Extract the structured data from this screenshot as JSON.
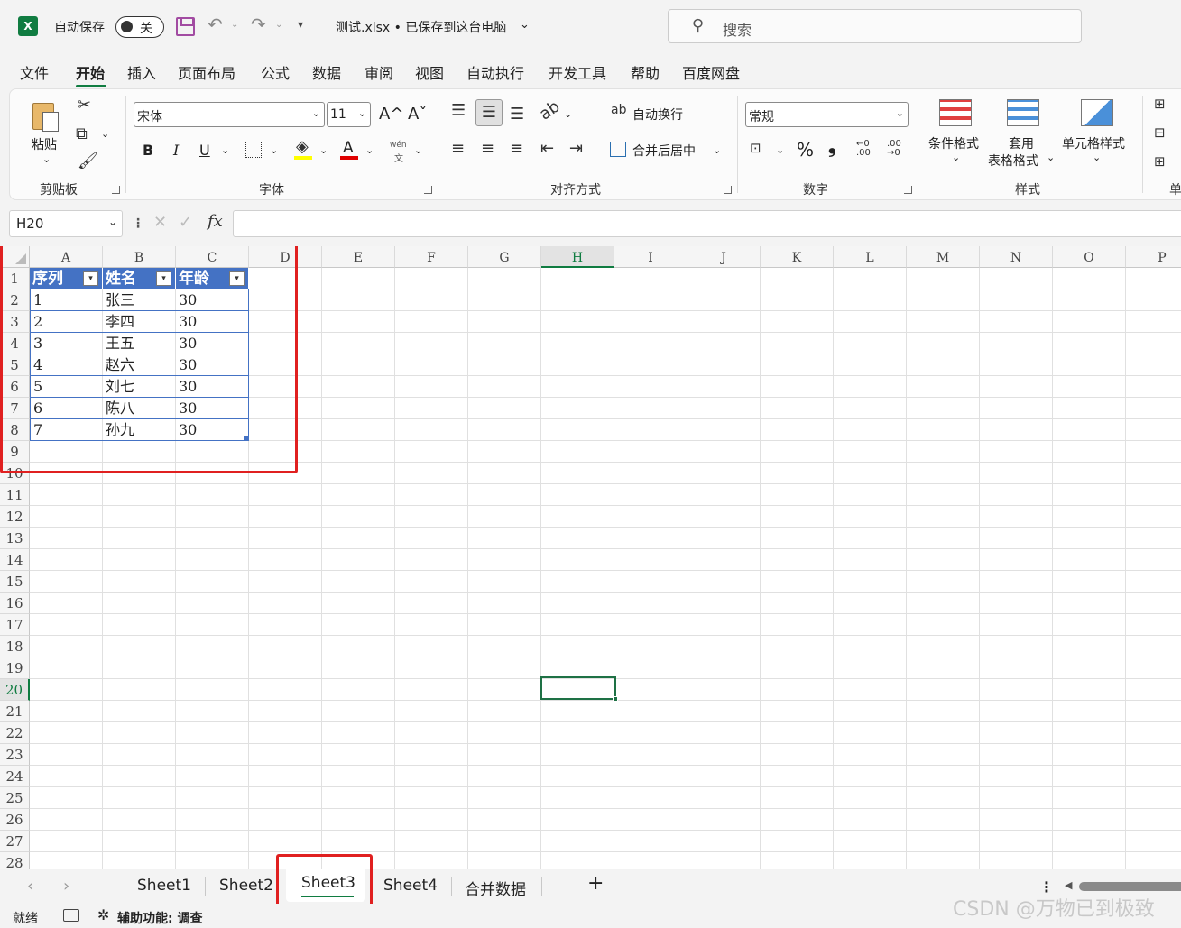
{
  "titlebar": {
    "autosave_label": "自动保存",
    "autosave_state": "关",
    "filename": "测试.xlsx • 已保存到这台电脑",
    "search_placeholder": "搜索"
  },
  "menu": {
    "tabs": [
      "文件",
      "开始",
      "插入",
      "页面布局",
      "公式",
      "数据",
      "审阅",
      "视图",
      "自动执行",
      "开发工具",
      "帮助",
      "百度网盘"
    ],
    "active": "开始"
  },
  "ribbon": {
    "clipboard": {
      "paste_label": "粘贴",
      "group_label": "剪贴板"
    },
    "font": {
      "font_name": "宋体",
      "font_size": "11",
      "bold": "B",
      "italic": "I",
      "underline": "U",
      "font_color_glyph": "A",
      "grow": "A^",
      "shrink": "Aˇ",
      "phonetic_top": "wén",
      "phonetic_bottom": "文",
      "group_label": "字体"
    },
    "alignment": {
      "wrap_text": "自动换行",
      "merge_center": "合并后居中",
      "group_label": "对齐方式"
    },
    "number": {
      "format": "常规",
      "percent": "%",
      "comma": "❟",
      "group_label": "数字"
    },
    "styles": {
      "conditional": "条件格式",
      "table_line1": "套用",
      "table_line2": "表格格式",
      "cell_styles": "单元格样式",
      "group_label": "样式"
    },
    "cells_group_label_partial": "单"
  },
  "formula_bar": {
    "name_box": "H20",
    "fx": "fx",
    "formula": ""
  },
  "grid": {
    "columns": [
      "A",
      "B",
      "C",
      "D",
      "E",
      "F",
      "G",
      "H",
      "I",
      "J",
      "K",
      "L",
      "M",
      "N",
      "O",
      "P"
    ],
    "rows": [
      "1",
      "2",
      "3",
      "4",
      "5",
      "6",
      "7",
      "8",
      "9",
      "10",
      "11",
      "12",
      "13",
      "14",
      "15",
      "16",
      "17",
      "18",
      "19",
      "20",
      "21",
      "22",
      "23",
      "24",
      "25",
      "26",
      "27",
      "28"
    ],
    "selected_cell": "H20",
    "table": {
      "headers": [
        "序列",
        "姓名",
        "年龄"
      ],
      "rows": [
        [
          "1",
          "张三",
          "30"
        ],
        [
          "2",
          "李四",
          "30"
        ],
        [
          "3",
          "王五",
          "30"
        ],
        [
          "4",
          "赵六",
          "30"
        ],
        [
          "5",
          "刘七",
          "30"
        ],
        [
          "6",
          "陈八",
          "30"
        ],
        [
          "7",
          "孙九",
          "30"
        ]
      ]
    }
  },
  "sheets": {
    "tabs": [
      "Sheet1",
      "Sheet2",
      "Sheet3",
      "Sheet4",
      "合并数据"
    ],
    "active": "Sheet3",
    "add": "+"
  },
  "status": {
    "ready": "就绪",
    "accessibility": "辅助功能: 调查",
    "watermark": "CSDN @万物已到极致"
  },
  "colors": {
    "accent": "#107c41",
    "table_header": "#4472c4",
    "highlight_box": "#e02020"
  }
}
